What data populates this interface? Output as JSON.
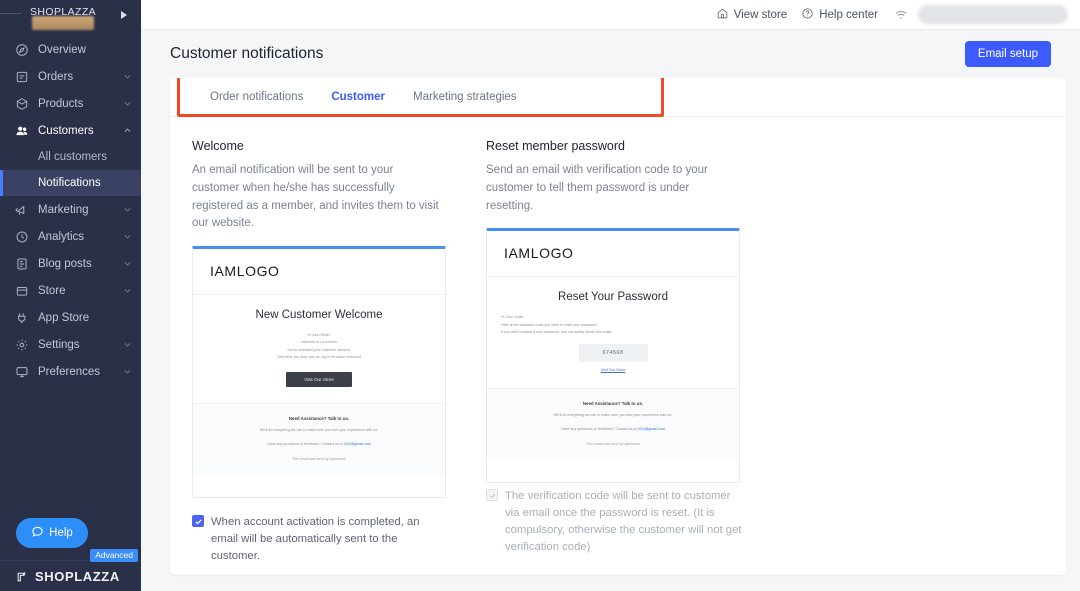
{
  "sidebar": {
    "brand": "SHOPLAZZA",
    "items": [
      {
        "label": "Overview",
        "icon": "compass-icon",
        "chevron": false,
        "active": false
      },
      {
        "label": "Orders",
        "icon": "receipt-icon",
        "chevron": true,
        "active": false
      },
      {
        "label": "Products",
        "icon": "box-icon",
        "chevron": true,
        "active": false
      },
      {
        "label": "Customers",
        "icon": "users-icon",
        "chevron": true,
        "active": true
      },
      {
        "label": "Marketing",
        "icon": "megaphone-icon",
        "chevron": true,
        "active": false
      },
      {
        "label": "Analytics",
        "icon": "clock-icon",
        "chevron": true,
        "active": false
      },
      {
        "label": "Blog posts",
        "icon": "article-icon",
        "chevron": true,
        "active": false
      },
      {
        "label": "Store",
        "icon": "storefront-icon",
        "chevron": true,
        "active": false
      },
      {
        "label": "App Store",
        "icon": "plug-icon",
        "chevron": false,
        "active": false
      },
      {
        "label": "Settings",
        "icon": "gear-icon",
        "chevron": true,
        "active": false
      },
      {
        "label": "Preferences",
        "icon": "monitor-icon",
        "chevron": true,
        "active": false
      }
    ],
    "sub_items": [
      {
        "label": "All customers",
        "selected": false
      },
      {
        "label": "Notifications",
        "selected": true
      }
    ],
    "help_label": "Help",
    "footer_logo": "SHOPLAZZA",
    "advanced_badge": "Advanced"
  },
  "topbar": {
    "view_store": "View store",
    "help_center": "Help center"
  },
  "header": {
    "title": "Customer notifications",
    "email_setup_label": "Email setup"
  },
  "tabs": [
    {
      "label": "Order notifications",
      "active": false
    },
    {
      "label": "Customer",
      "active": true
    },
    {
      "label": "Marketing strategies",
      "active": false
    }
  ],
  "sections": [
    {
      "title": "Welcome",
      "description": "An email notification will be sent to your customer when he/she has successfully registered as a member, and invites them to visit our website.",
      "preview": {
        "logo": "IAMLOGO",
        "heading": "New Customer Welcome",
        "lines": [
          "Hi  John Smith,",
          "welcome to La-lemues",
          "You've activated your customer account.",
          "Next time you drop with us, log in for faster checkout"
        ],
        "button": "Visit Our Store",
        "footer_heading": "Need Assistance? Talk to us.",
        "footer_line1": "We'll do everything we can to make sure you love your experience with us.",
        "footer_line2_pre": "Have any questions or feedback? Contact us at ",
        "footer_mail": "XXX@gmail.com",
        "footer_sig": "This email was sent by loginname"
      },
      "checkbox": {
        "checked": true,
        "enabled": true,
        "text": "When account activation is completed, an email will be automatically sent to the customer."
      }
    },
    {
      "title": "Reset member password",
      "description": "Send an email with verification code to your customer to tell them password is under resetting.",
      "preview": {
        "logo": "IAMLOGO",
        "heading": "Reset Your Password",
        "lines": [
          "Hi  John Smith,",
          "Here is the validation code you need to reset your password.",
          "If you didn't request a new password, you can safely delete this email."
        ],
        "code": "674568",
        "link": "Visit Our Store",
        "footer_heading": "Need Assistance? Talk to us.",
        "footer_line1": "We'll do everything we can to make sure you love your experience with us.",
        "footer_line2_pre": "Have any questions or feedback? Contact us at ",
        "footer_mail": "XXX@gmail.com",
        "footer_sig": "This email was sent by loginname"
      },
      "checkbox": {
        "checked": true,
        "enabled": false,
        "text": "The verification code will be sent to customer via email once the password is reset. (It is compulsory, otherwise the customer will not get verification code)"
      }
    }
  ],
  "colors": {
    "sidebar_bg": "#2b3049",
    "accent_blue": "#3b5bfc",
    "highlight_red": "#ef4a23",
    "preview_top_border": "#4a8ff0"
  }
}
